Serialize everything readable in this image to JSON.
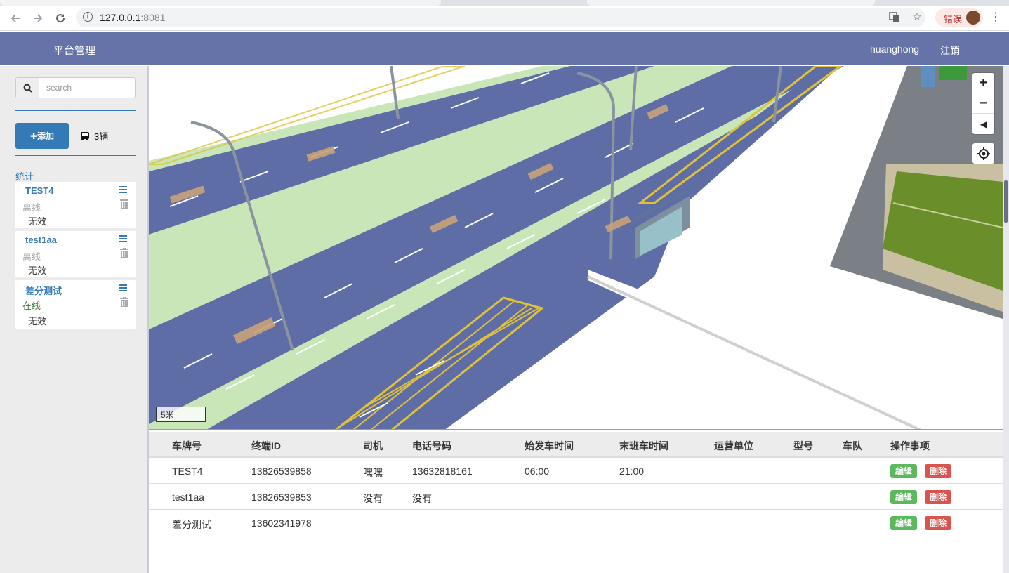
{
  "browser": {
    "url_host": "127.0.0.1",
    "url_port": ":8081",
    "error_chip_label": "错误",
    "icons": [
      "back-icon",
      "forward-icon",
      "reload-icon",
      "info-icon",
      "translate-icon",
      "star-icon",
      "kebab-menu-icon"
    ]
  },
  "navbar": {
    "brand": "平台管理",
    "user": "huanghong",
    "logout": "注销"
  },
  "sidebar": {
    "search_placeholder": "search",
    "add_label": "✚添加",
    "bus_count": "3辆",
    "stats_label": "统计",
    "vehicles": [
      {
        "name": "TEST4",
        "status": "离线",
        "status_type": "offline",
        "validity": "无效"
      },
      {
        "name": "test1aa",
        "status": "离线",
        "status_type": "offline",
        "validity": "无效"
      },
      {
        "name": "差分测试",
        "status": "在线",
        "status_type": "online",
        "validity": "无效"
      }
    ]
  },
  "map": {
    "scale_label": "5米",
    "controls": [
      "zoom-in-icon",
      "zoom-out-icon",
      "compass-icon",
      "locate-icon"
    ]
  },
  "table": {
    "headers": [
      "车牌号",
      "终端ID",
      "司机",
      "电话号码",
      "始发车时间",
      "末班车时间",
      "运营单位",
      "型号",
      "车队",
      "操作事项"
    ],
    "rows": [
      {
        "plate": "TEST4",
        "terminal_id": "13826539858",
        "driver": "嘿嘿",
        "phone": "13632818161",
        "first_time": "06:00",
        "last_time": "21:00",
        "operator": "",
        "model": "",
        "fleet": ""
      },
      {
        "plate": "test1aa",
        "terminal_id": "13826539853",
        "driver": "没有",
        "phone": "没有",
        "first_time": "",
        "last_time": "",
        "operator": "",
        "model": "",
        "fleet": ""
      },
      {
        "plate": "差分测试",
        "terminal_id": "13602341978",
        "driver": "",
        "phone": "",
        "first_time": "",
        "last_time": "",
        "operator": "",
        "model": "",
        "fleet": ""
      }
    ],
    "edit_label": "编辑",
    "delete_label": "删除"
  },
  "colors": {
    "navbar": "#6673a8",
    "primary": "#337ab7",
    "success": "#5cb85c",
    "danger": "#d9534f",
    "road": "#5f6da6",
    "median": "#c8e6b8"
  }
}
